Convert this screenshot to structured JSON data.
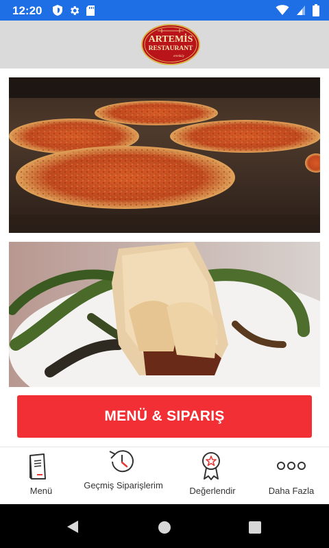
{
  "status_bar": {
    "time": "12:20",
    "left_icons": [
      "shield-icon",
      "gear-icon",
      "sd-card-icon"
    ],
    "right_icons": [
      "wifi-icon",
      "signal-icon",
      "battery-icon"
    ],
    "color": "#1e6fe6"
  },
  "header": {
    "logo": {
      "line1": "ARTEMİS",
      "line2": "RESTAURANT",
      "tagline": "erenköy"
    },
    "background": "#dadada"
  },
  "images": [
    {
      "subject": "lahmacun-in-oven"
    },
    {
      "subject": "wrap-with-grilled-peppers"
    }
  ],
  "cta": {
    "label": "MENÜ & SIPARIŞ",
    "color": "#f22f34"
  },
  "bottom_nav": {
    "items": [
      {
        "label": "Menü",
        "icon": "menu-book-icon"
      },
      {
        "label": "Geçmiş Siparişlerim",
        "icon": "history-clock-icon"
      },
      {
        "label": "Değerlendir",
        "icon": "rating-badge-icon"
      },
      {
        "label": "Daha Fazla",
        "icon": "more-dots-icon"
      }
    ]
  },
  "android_nav": {
    "buttons": [
      "back-button",
      "home-button",
      "recents-button"
    ]
  }
}
